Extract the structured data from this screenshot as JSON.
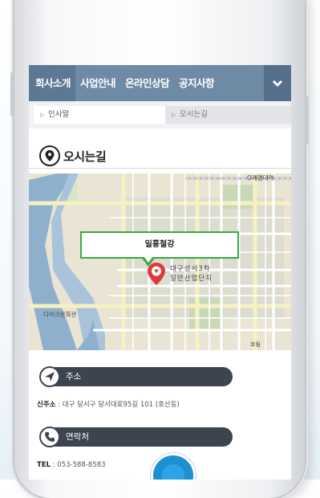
{
  "nav": {
    "items": [
      {
        "label": "회사소개"
      },
      {
        "label": "사업안내"
      },
      {
        "label": "온라인상담"
      },
      {
        "label": "공지사항"
      }
    ],
    "more_icon": "chevron-down-icon"
  },
  "subtabs": [
    {
      "label": "인사말"
    },
    {
      "label": "오시는길"
    }
  ],
  "page": {
    "title": "오시는길",
    "icon": "location-pin-icon"
  },
  "map": {
    "callout": "일흥철강",
    "address_line1": "대구성서3차",
    "address_line2": "일반산업단지",
    "label_top_right": "O계명대역",
    "label_left": "디아크문화관",
    "label_bottom_right": "호림"
  },
  "address_section": {
    "title": "주소",
    "label": "신주소",
    "value": ": 대구 달서구 달서대로95길 101 (호산동)"
  },
  "contact_section": {
    "title": "연락처",
    "label": "TEL",
    "value": ": 053-588-8583"
  },
  "colors": {
    "nav": "#6e8aa5",
    "bar": "#3c4450",
    "callout_border": "#3aa845",
    "pin": "#e0393d"
  }
}
